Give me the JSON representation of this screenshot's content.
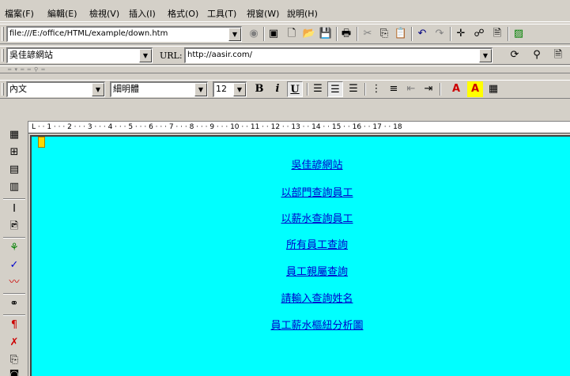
{
  "menu": {
    "file": "檔案(F)",
    "edit": "編輯(E)",
    "view": "檢視(V)",
    "insert": "插入(I)",
    "format": "格式(O)",
    "tools": "工具(T)",
    "window": "視窗(W)",
    "help": "說明(H)"
  },
  "address_bar": {
    "path": "file:///E:/office/HTML/example/down.htm"
  },
  "title_bar_row": {
    "site_name": "吳佳諺網站",
    "url_label": "URL:",
    "url_value": "http://aasir.com/"
  },
  "format_bar": {
    "style": "內文",
    "font": "細明體",
    "size": "12",
    "bold": "B",
    "italic": "i",
    "underline": "U",
    "font_color": "A",
    "highlight": "A"
  },
  "ruler": {
    "text": "L · · 1 · · · 2 · · · 3 · · · 4 · · · 5 · · · 6 · · · 7 · · · 8 · · · 9 · · · 10 · · 11 · · 12 · · 13 · · 14 · · 15 · · 16 · · 17 · · 18"
  },
  "document": {
    "background_color": "#00ffff",
    "link_color": "#0000cc",
    "links": [
      "吳佳諺網站",
      "以部門查詢員工",
      "以薪水查詢員工",
      "所有員工查詢",
      "員工親屬查詢",
      "請輸入查詢姓名",
      "員工薪水樞紐分析圖"
    ]
  }
}
